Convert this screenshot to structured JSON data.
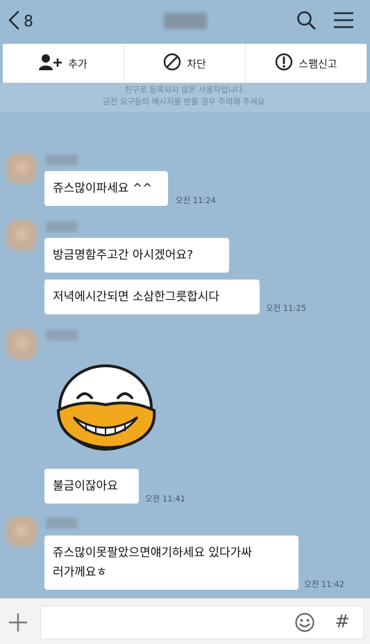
{
  "header": {
    "back_count": "8",
    "icons": [
      "back-chevron-icon",
      "search-icon",
      "menu-icon"
    ]
  },
  "actions": [
    {
      "label": "추가",
      "icon": "add-friend-icon"
    },
    {
      "label": "차단",
      "icon": "block-icon"
    },
    {
      "label": "스팸신고",
      "icon": "report-icon"
    }
  ],
  "notice": {
    "line1": "친구로 등록되지 않은 사용자입니다.",
    "line2": "금전 요구등의 메시지를 받을 경우 주의해 주세요."
  },
  "messages": [
    {
      "text": "쥬스많이파세요 ^^",
      "time": "오전 11:24"
    },
    {
      "text": "방금명함주고간 아시겠어요?",
      "time": ""
    },
    {
      "text": "저녁에시간되면 소삼한그릇합시다",
      "time": "오전 11:25"
    },
    {
      "text": "불금이잖아요",
      "time": "오전 11:41"
    },
    {
      "text_line1": "쥬스많이못팔았으면얘기하세요 있다가싸",
      "text_line2": "러가께요ㅎ",
      "time": "오전 11:42"
    }
  ],
  "composer": {
    "placeholder": "",
    "icons": [
      "plus-icon",
      "emoji-icon",
      "hashtag-icon"
    ],
    "hash_label": "#"
  },
  "colors": {
    "background": "#9bbbd4",
    "bubble": "#ffffff",
    "emoticon_face": "#ffffff",
    "emoticon_beak": "#f2a81d"
  }
}
